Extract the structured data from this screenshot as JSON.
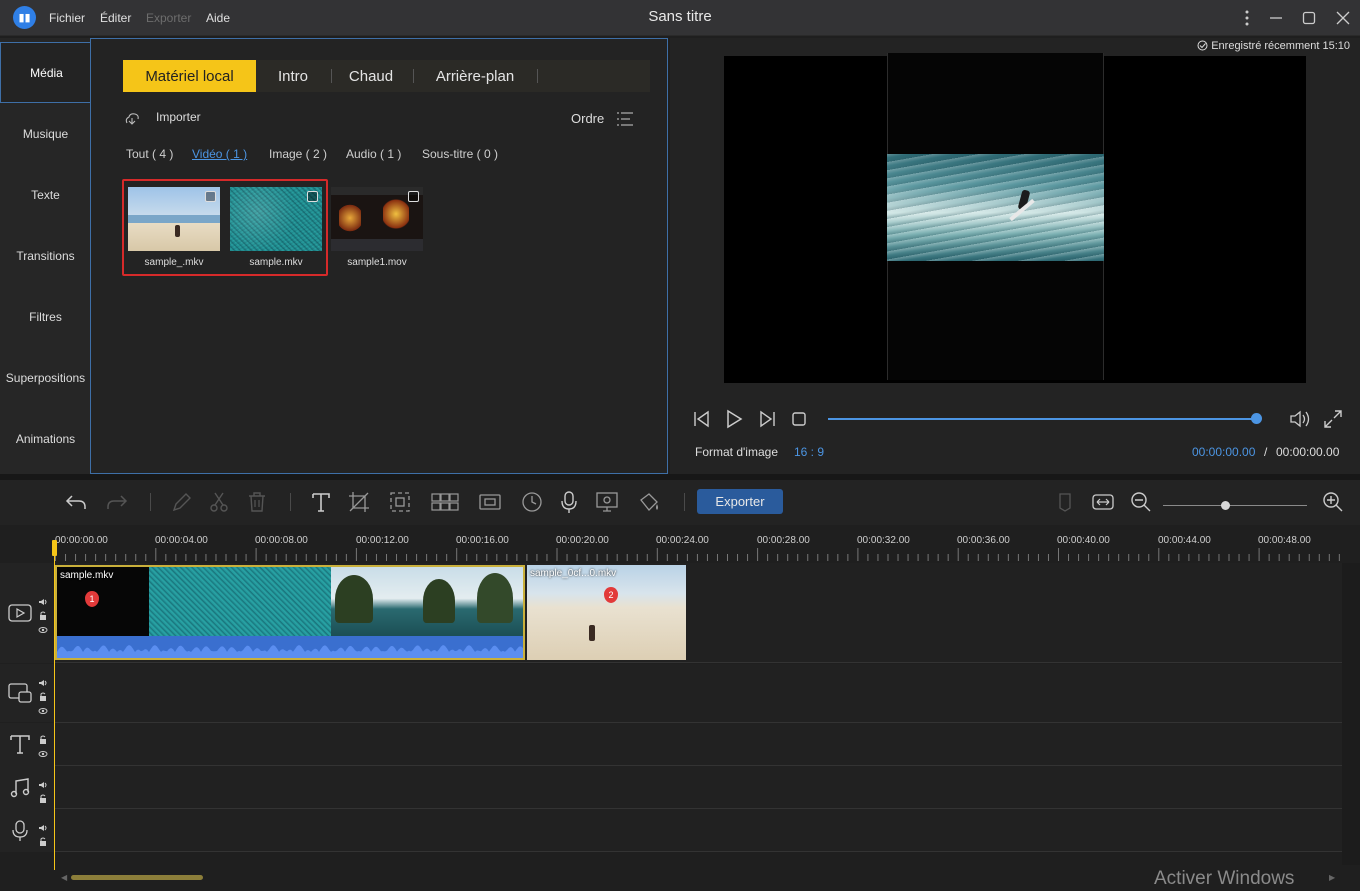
{
  "app": {
    "title": "Sans titre",
    "menu": [
      "Fichier",
      "Éditer",
      "Exporter",
      "Aide"
    ],
    "menu_disabled": [
      false,
      false,
      true,
      false
    ]
  },
  "sidebar": {
    "items": [
      {
        "label": "Média",
        "active": true
      },
      {
        "label": "Musique"
      },
      {
        "label": "Texte"
      },
      {
        "label": "Transitions"
      },
      {
        "label": "Filtres"
      },
      {
        "label": "Superpositions"
      },
      {
        "label": "Animations"
      }
    ]
  },
  "media": {
    "tabs": [
      "Matériel local",
      "Intro",
      "Chaud",
      "Arrière-plan"
    ],
    "active_tab": "Matériel local",
    "import_label": "Importer",
    "order_label": "Ordre",
    "filters": [
      "Tout ( 4 )",
      "Vidéo ( 1 )",
      "Image ( 2 )",
      "Audio ( 1 )",
      "Sous-titre ( 0 )"
    ],
    "active_filter": "Vidéo ( 1 )",
    "files": [
      {
        "name": "sample_.mkv",
        "selected": true
      },
      {
        "name": "sample.mkv",
        "selected": true
      },
      {
        "name": "sample1.mov",
        "selected": false
      }
    ]
  },
  "preview": {
    "saved_status": "Enregistré récemment 15:10",
    "format_label": "Format d'image",
    "format_value": "16 : 9",
    "current_time": "00:00:00.00",
    "time_separator": "/",
    "total_time": "00:00:00.00",
    "progress": 1.0
  },
  "toolbar": {
    "export_label": "Exporter",
    "zoom_level": 0.4
  },
  "timeline": {
    "ruler": [
      "00:00:00.00",
      "00:00:04.00",
      "00:00:08.00",
      "00:00:12.00",
      "00:00:16.00",
      "00:00:20.00",
      "00:00:24.00",
      "00:00:28.00",
      "00:00:32.00",
      "00:00:36.00",
      "00:00:40.00",
      "00:00:44.00",
      "00:00:48.00"
    ],
    "clips": [
      {
        "label": "sample.mkv",
        "badge": "1"
      },
      {
        "label": "sample_0cf...0.mkv",
        "badge": "2"
      }
    ]
  },
  "system": {
    "watermark": "Activer Windows"
  },
  "colors": {
    "accent_yellow": "#f5c518",
    "accent_blue": "#4c95e3",
    "selection_red": "#d62a2a"
  }
}
